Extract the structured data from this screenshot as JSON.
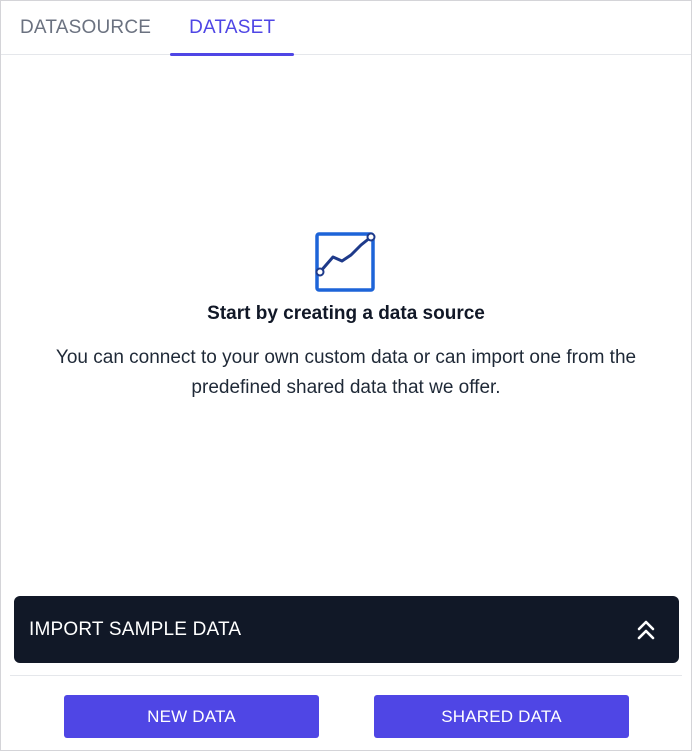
{
  "tabs": [
    {
      "label": "DATASOURCE",
      "active": false
    },
    {
      "label": "DATASET",
      "active": true
    }
  ],
  "empty_state": {
    "icon": "line-chart-icon",
    "title": "Start by creating a data source",
    "description": "You can connect to your own custom data or can import one from the predefined shared data that we offer."
  },
  "import_bar": {
    "label": "IMPORT SAMPLE DATA",
    "icon": "double-chevron-up-icon"
  },
  "actions": {
    "new_data": "NEW DATA",
    "shared_data": "SHARED DATA"
  },
  "colors": {
    "accent": "#4f46e5",
    "dark_bar": "#111827",
    "icon_blue": "#1d64d8"
  }
}
